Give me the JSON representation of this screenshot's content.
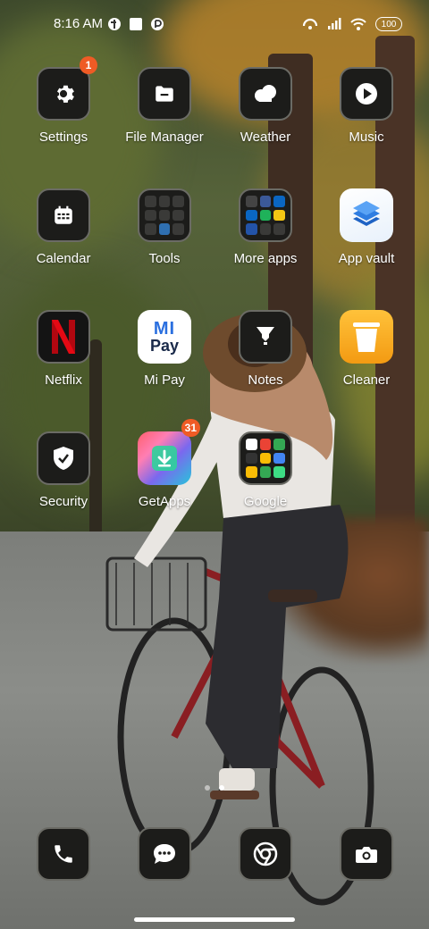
{
  "status_bar": {
    "time": "8:16 AM",
    "battery": "100"
  },
  "apps": [
    {
      "label": "Settings",
      "badge": "1"
    },
    {
      "label": "File Manager"
    },
    {
      "label": "Weather"
    },
    {
      "label": "Music"
    },
    {
      "label": "Calendar"
    },
    {
      "label": "Tools"
    },
    {
      "label": "More apps"
    },
    {
      "label": "App vault"
    },
    {
      "label": "Netflix"
    },
    {
      "label": "Mi Pay",
      "logo_line1": "MI",
      "logo_line2": "Pay"
    },
    {
      "label": "Notes"
    },
    {
      "label": "Cleaner"
    },
    {
      "label": "Security"
    },
    {
      "label": "GetApps",
      "badge": "31"
    },
    {
      "label": "Google"
    }
  ],
  "dock": [
    "phone-icon",
    "messages-icon",
    "chrome-icon",
    "camera-icon"
  ],
  "page_indicator": {
    "count": 2,
    "active": 1
  },
  "colors": {
    "badge": "#ef5b25",
    "tile_dark": "#1c1c1a",
    "tile_border": "#6b6b65",
    "netflix_red": "#e50914",
    "cleaner_orange": "#f7a21b"
  }
}
